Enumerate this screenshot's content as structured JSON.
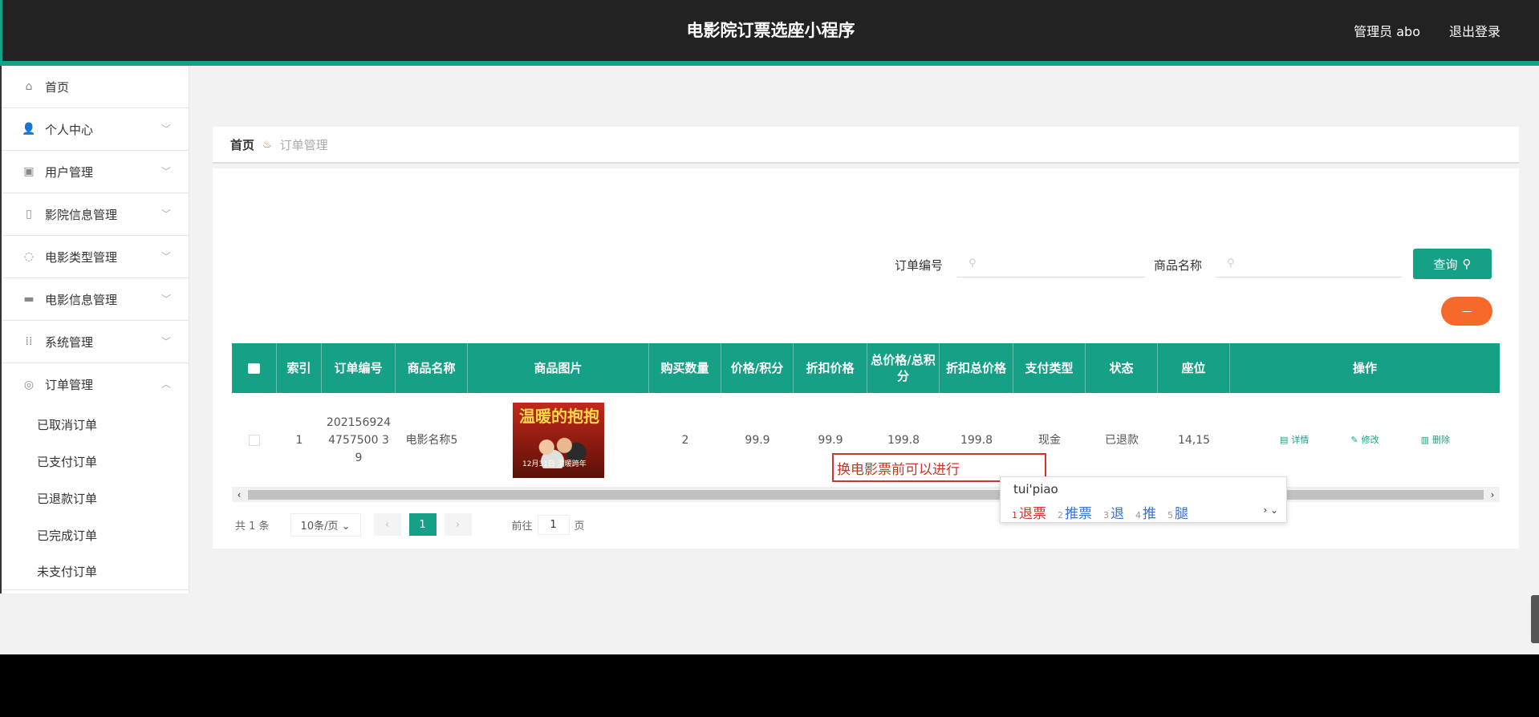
{
  "header": {
    "title": "电影院订票选座小程序",
    "admin_label": "管理员 abo",
    "logout_label": "退出登录"
  },
  "sidebar": {
    "items": [
      {
        "label": "首页",
        "icon": "home-icon"
      },
      {
        "label": "个人中心",
        "icon": "user-icon"
      },
      {
        "label": "用户管理",
        "icon": "briefcase-icon"
      },
      {
        "label": "影院信息管理",
        "icon": "cinema-icon"
      },
      {
        "label": "电影类型管理",
        "icon": "power-icon"
      },
      {
        "label": "电影信息管理",
        "icon": "monitor-icon"
      },
      {
        "label": "系统管理",
        "icon": "frame-icon"
      },
      {
        "label": "订单管理",
        "icon": "globe-icon"
      }
    ],
    "submenu": [
      "已取消订单",
      "已支付订单",
      "已退款订单",
      "已完成订单",
      "未支付订单"
    ]
  },
  "breadcrumb": {
    "home": "首页",
    "current": "订单管理"
  },
  "search": {
    "order_no_label": "订单编号",
    "product_name_label": "商品名称",
    "query_label": "查询"
  },
  "table": {
    "headers": [
      "",
      "索引",
      "订单编号",
      "商品名称",
      "商品图片",
      "购买数量",
      "价格/积分",
      "折扣价格",
      "总价格/总积分",
      "折扣总价格",
      "支付类型",
      "状态",
      "座位",
      "操作"
    ],
    "row": {
      "index": "1",
      "order_no": "2021569244757500 39",
      "product_name": "电影名称5",
      "poster_text": "温暖的抱抱",
      "poster_bottom": "12月31日 温暖跨年",
      "quantity": "2",
      "price": "99.9",
      "discount_price": "99.9",
      "total_price": "199.8",
      "discount_total": "199.8",
      "pay_type": "现金",
      "status": "已退款",
      "seat": "14,15",
      "actions": [
        "详情",
        "修改",
        "删除"
      ]
    }
  },
  "pager": {
    "total": "共 1 条",
    "page_size": "10条/页",
    "current_page": "1",
    "goto_label": "前往",
    "goto_value": "1",
    "page_unit": "页"
  },
  "ime": {
    "typed": "换电影票前可以进行",
    "pinyin": "tui'piao",
    "candidates": [
      {
        "n": "1",
        "text": "退票"
      },
      {
        "n": "2",
        "text": "推票"
      },
      {
        "n": "3",
        "text": "退"
      },
      {
        "n": "4",
        "text": "推"
      },
      {
        "n": "5",
        "text": "腿"
      }
    ]
  },
  "colors": {
    "accent": "#16a085",
    "header_bg": "#222222",
    "delete_btn": "#f56a2a"
  }
}
